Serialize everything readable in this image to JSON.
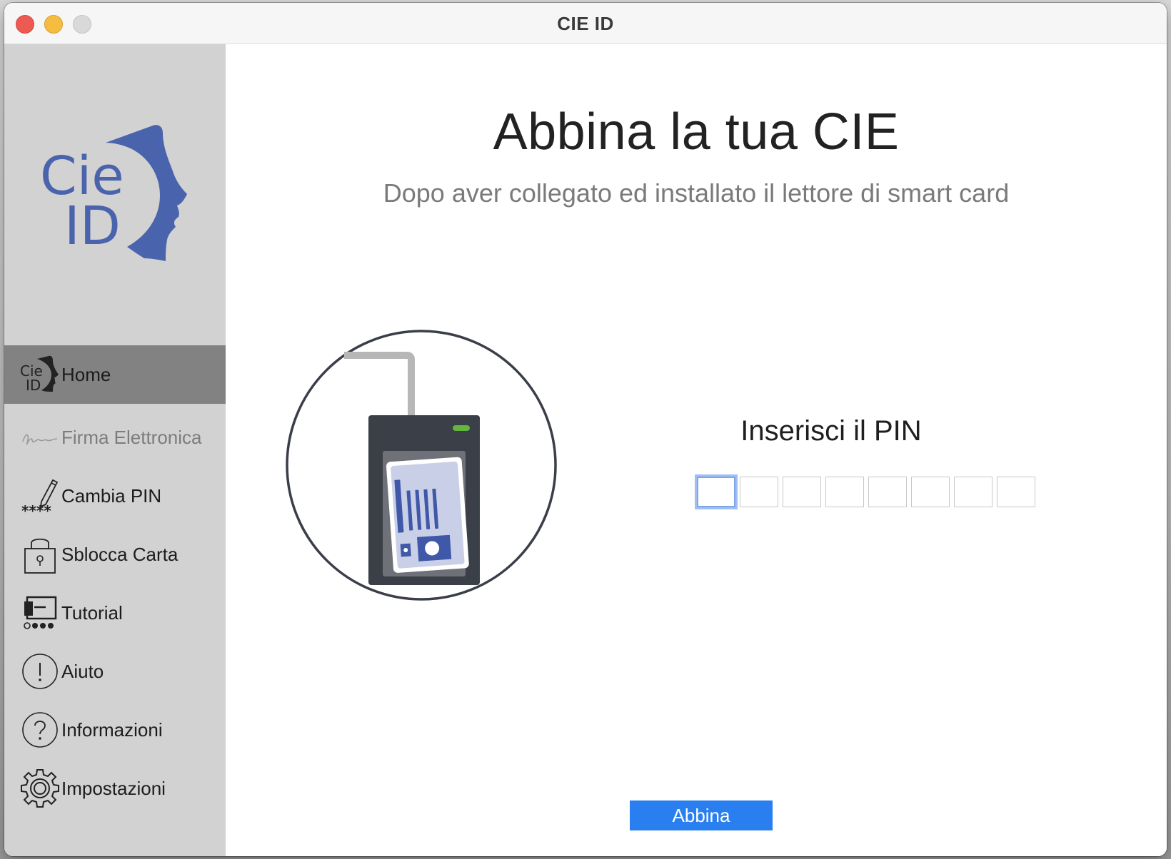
{
  "window": {
    "title": "CIE ID"
  },
  "sidebar": {
    "logo_text_1": "Cie",
    "logo_text_2": "ID",
    "items": [
      {
        "label": "Home",
        "icon": "cie-id-icon",
        "state": "active"
      },
      {
        "label": "Firma Elettronica",
        "icon": "signature-icon",
        "state": "disabled"
      },
      {
        "label": "Cambia PIN",
        "icon": "pencil-pin-icon",
        "state": "normal"
      },
      {
        "label": "Sblocca Carta",
        "icon": "padlock-icon",
        "state": "normal"
      },
      {
        "label": "Tutorial",
        "icon": "presentation-icon",
        "state": "normal"
      },
      {
        "label": "Aiuto",
        "icon": "exclamation-circle-icon",
        "state": "normal"
      },
      {
        "label": "Informazioni",
        "icon": "question-circle-icon",
        "state": "normal"
      },
      {
        "label": "Impostazioni",
        "icon": "gear-icon",
        "state": "normal"
      }
    ],
    "home_icon_text_1": "Cie",
    "home_icon_text_2": "ID",
    "cambia_pin_icon_text": "****"
  },
  "main": {
    "title": "Abbina la tua CIE",
    "subtitle": "Dopo aver collegato ed installato il lettore di smart card",
    "pin_label": "Inserisci il PIN",
    "pin_digits": [
      "",
      "",
      "",
      "",
      "",
      "",
      "",
      ""
    ],
    "submit_label": "Abbina"
  },
  "colors": {
    "accent": "#2a7ff0",
    "logo_blue": "#4a63ad",
    "sidebar_bg": "#d2d2d2",
    "active_item_bg": "#828282",
    "reader_led": "#63b53d"
  }
}
